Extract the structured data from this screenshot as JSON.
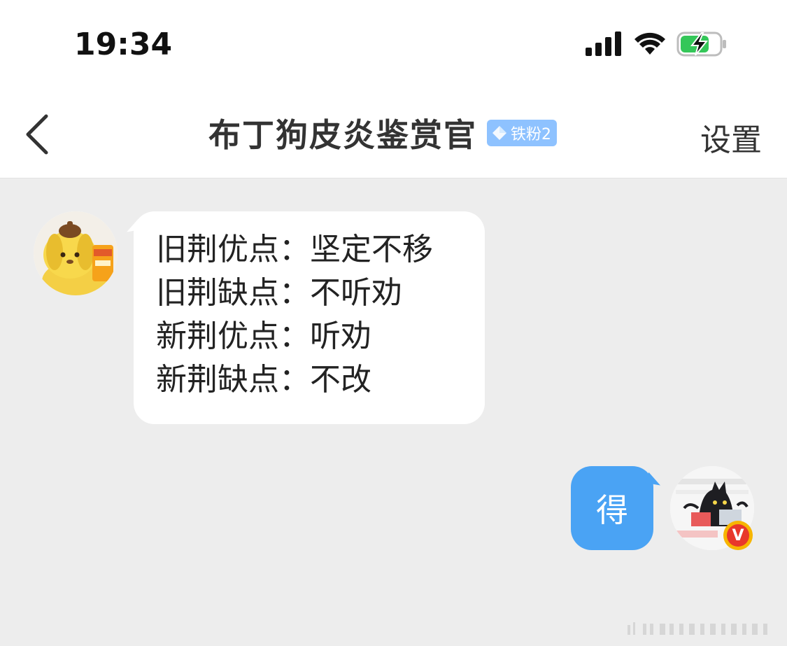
{
  "status_bar": {
    "time": "19:34",
    "icons": [
      "signal-icon",
      "wifi-icon",
      "battery-charging-icon"
    ]
  },
  "nav": {
    "back_icon": "chevron-left-icon",
    "title": "布丁狗皮炎鉴赏官",
    "badge_label": "铁粉2",
    "badge_icon": "diamond-icon",
    "badge_color": "#8ec2ff",
    "settings_label": "设置"
  },
  "conversation": {
    "incoming": {
      "avatar": "pompompurin-avatar",
      "lines": [
        "旧荆优点：坚定不移",
        "旧荆缺点：不听劝",
        "新荆优点：听劝",
        "新荆缺点：不改"
      ]
    },
    "outgoing": {
      "avatar": "black-cat-avatar",
      "verified_badge": "V",
      "text": "得",
      "bubble_color": "#4aa3f4"
    }
  },
  "colors": {
    "background": "#ededed",
    "accent": "#4aa3f4"
  }
}
